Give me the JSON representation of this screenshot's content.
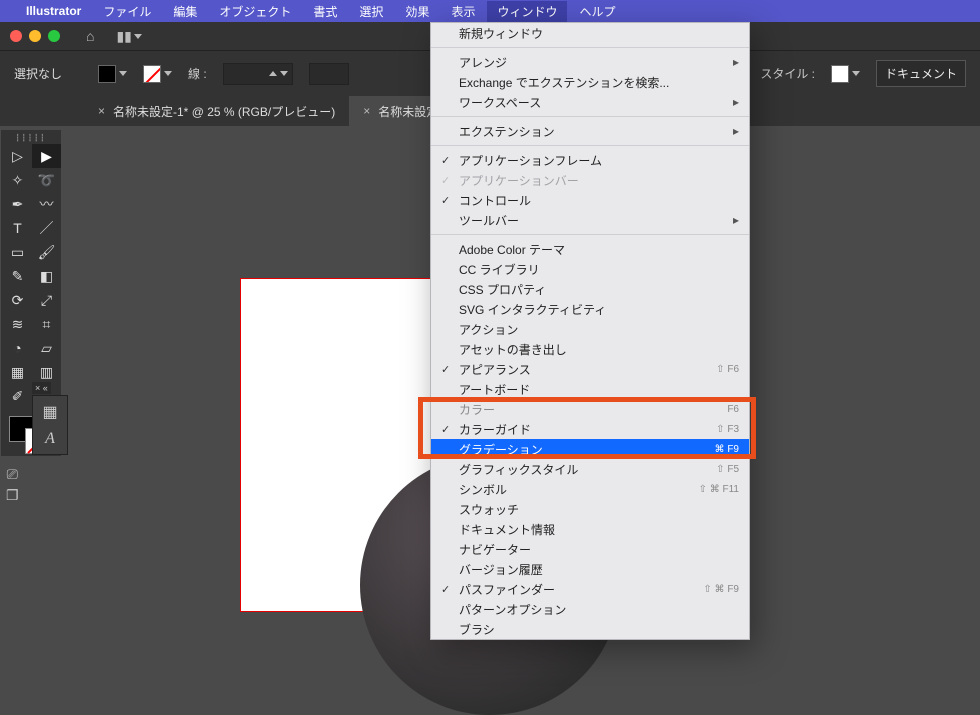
{
  "menubar": {
    "app": "Illustrator",
    "items": [
      "ファイル",
      "編集",
      "オブジェクト",
      "書式",
      "選択",
      "効果",
      "表示",
      "ウィンドウ",
      "ヘルプ"
    ],
    "active": "ウィンドウ"
  },
  "options": {
    "selection": "選択なし",
    "stroke_label": "線 :",
    "opacity_label": "",
    "style_label": "スタイル :",
    "doc_btn": "ドキュメント"
  },
  "tabs": [
    {
      "label": "名称未設定-1* @ 25 % (RGB/プレビュー)",
      "active": false
    },
    {
      "label": "名称未設定",
      "active": true
    }
  ],
  "menu": {
    "new_window": "新規ウィンドウ",
    "arrange": "アレンジ",
    "exchange": "Exchange でエクステンションを検索...",
    "workspace": "ワークスペース",
    "extensions": "エクステンション",
    "app_frame": "アプリケーションフレーム",
    "app_bar": "アプリケーションバー",
    "control": "コントロール",
    "toolbar": "ツールバー",
    "adobe_color": "Adobe Color テーマ",
    "cc_lib": "CC ライブラリ",
    "css_prop": "CSS プロパティ",
    "svg_inter": "SVG インタラクティビティ",
    "actions": "アクション",
    "asset_export": "アセットの書き出し",
    "appearance": "アピアランス",
    "artboard": "アートボード",
    "color": "カラー",
    "color_guide": "カラーガイド",
    "gradient": "グラデーション",
    "graphic_styles": "グラフィックスタイル",
    "symbols": "シンボル",
    "swatches": "スウォッチ",
    "doc_info": "ドキュメント情報",
    "navigator": "ナビゲーター",
    "version_hist": "バージョン履歴",
    "pathfinder": "パスファインダー",
    "pattern_opts": "パターンオプション",
    "brushes": "ブラシ",
    "sc_appearance": "⇧ F6",
    "sc_color": "F6",
    "sc_color_guide": "⇧ F3",
    "sc_gradient": "⌘ F9",
    "sc_graphic_styles": "⇧ F5",
    "sc_symbols": "⇧ ⌘ F11",
    "sc_pathfinder": "⇧ ⌘ F9"
  }
}
